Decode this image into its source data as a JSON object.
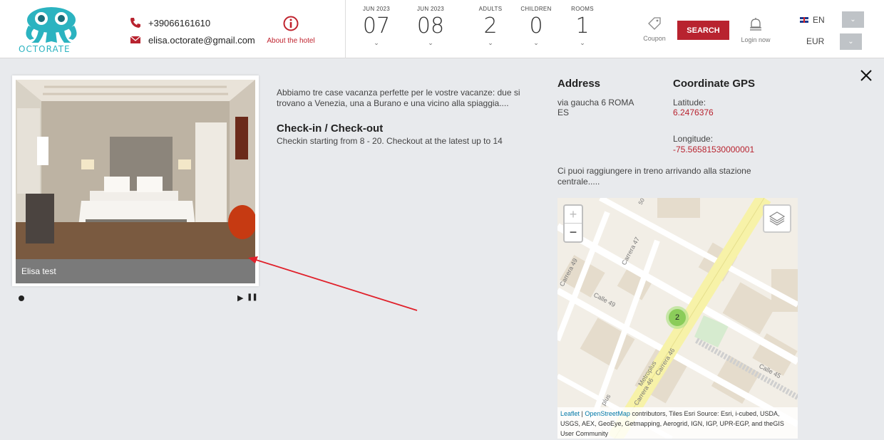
{
  "header": {
    "logo_text": "OCTORATE",
    "phone": "+39066161610",
    "email": "elisa.octorate@gmail.com",
    "about_label": "About the hotel",
    "booking": [
      {
        "caption": "JUN 2023",
        "value": "07"
      },
      {
        "caption": "JUN 2023",
        "value": "08"
      },
      {
        "caption": "ADULTS",
        "value": "2"
      },
      {
        "caption": "CHILDREN",
        "value": "0"
      },
      {
        "caption": "ROOMS",
        "value": "1"
      }
    ],
    "coupon_label": "Coupon",
    "search_label": "SEARCH",
    "login_label": "Login now",
    "language": "EN",
    "currency": "EUR"
  },
  "gallery": {
    "caption": "Elisa test"
  },
  "info": {
    "description": "Abbiamo tre case vacanza perfette per le vostre vacanze: due si trovano a Venezia, una a Burano e una vicino alla spiaggia....",
    "checkin_title": "Check-in / Check-out",
    "checkin_text": "Checkin starting from 8 - 20. Checkout at the latest up to 14"
  },
  "location": {
    "address_title": "Address",
    "address_line1": "via gaucha 6 ROMA",
    "address_line2": "ES",
    "gps_title": "Coordinate GPS",
    "latitude_label": "Latitude:",
    "latitude_value": "6.2476376",
    "longitude_label": "Longitude:",
    "longitude_value": "-75.56581530000001",
    "directions": "Ci puoi raggiungere in treno arrivando alla stazione centrale....."
  },
  "map": {
    "zoom_in": "+",
    "zoom_out": "−",
    "cluster_count": "2",
    "labels": {
      "carrera47": "Carrera 47",
      "calle49": "Calle 49",
      "carrera49": "Carrera 49",
      "metroplus": "Metroplus",
      "carrera46": "Carrera 46",
      "calle45": "Calle 45",
      "carrera46b": "Carrera 46",
      "metroplus2": "plus",
      "calle50": "50"
    },
    "attribution_leaflet": "Leaflet",
    "attribution_sep": " | ",
    "attribution_osm": "OpenStreetMap",
    "attribution_rest": " contributors, Tiles Esri Source: Esri, i-cubed, USDA, USGS, AEX, GeoEye, Getmapping, Aerogrid, IGN, IGP, UPR-EGP, and theGIS User Community"
  },
  "colors": {
    "brand_teal": "#2bb3c0",
    "accent_red": "#b8232f",
    "page_bg": "#e8eaed"
  }
}
